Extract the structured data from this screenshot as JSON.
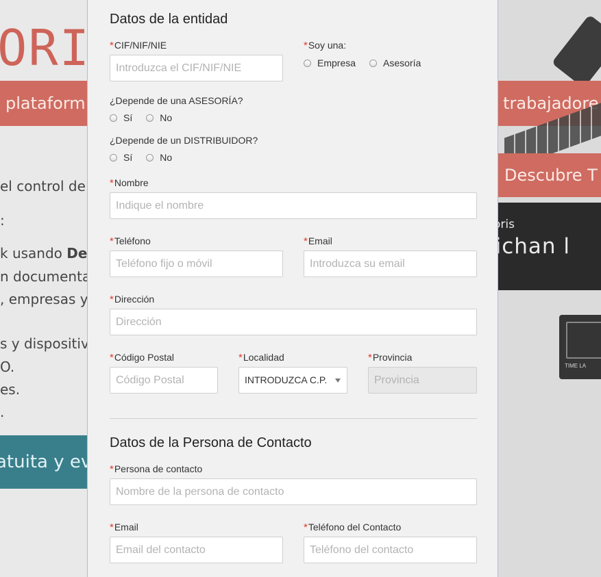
{
  "background": {
    "logo_text": "ORIS",
    "band_left": "plataform",
    "band_right_1": "s trabajadore",
    "band_right_2": "Descubre T",
    "lines": [
      {
        "pre": "el control de p",
        "bold": ""
      },
      {
        "pre": ":",
        "bold": ""
      },
      {
        "pre": "k usando ",
        "bold": "Del"
      },
      {
        "pre": "n documental",
        "bold": ""
      },
      {
        "pre": ", empresas y t",
        "bold": ""
      },
      {
        "pre": "s y dispositivo",
        "bold": ""
      },
      {
        "pre": "O.",
        "bold": ""
      },
      {
        "pre": "es.",
        "bold": ""
      },
      {
        "pre": ".",
        "bold": ""
      }
    ],
    "teal_band": "atuita y ev",
    "dark_small": "oris",
    "dark_big": "Fichan l",
    "device_label": "TIME LA"
  },
  "form": {
    "entity_title": "Datos de la entidad",
    "cif": {
      "label": "CIF/NIF/NIE",
      "placeholder": "Introduzca el CIF/NIF/NIE"
    },
    "soy_una": {
      "label": "Soy una:",
      "options": [
        "Empresa",
        "Asesoría"
      ]
    },
    "asesoria": {
      "label": "¿Depende de una ASESORÍA?",
      "options": [
        "Sí",
        "No"
      ]
    },
    "distribuidor": {
      "label": "¿Depende de un DISTRIBUIDOR?",
      "options": [
        "Sí",
        "No"
      ]
    },
    "nombre": {
      "label": "Nombre",
      "placeholder": "Indique el nombre"
    },
    "telefono": {
      "label": "Teléfono",
      "placeholder": "Teléfono fijo o móvil"
    },
    "email": {
      "label": "Email",
      "placeholder": "Introduzca su email"
    },
    "direccion": {
      "label": "Dirección",
      "placeholder": "Dirección"
    },
    "cp": {
      "label": "Código Postal",
      "placeholder": "Código Postal"
    },
    "localidad": {
      "label": "Localidad",
      "value": "INTRODUZCA C.P."
    },
    "provincia": {
      "label": "Provincia",
      "placeholder": "Provincia"
    },
    "contact_title": "Datos de la Persona de Contacto",
    "persona": {
      "label": "Persona de contacto",
      "placeholder": "Nombre de la persona de contacto"
    },
    "contact_email": {
      "label": "Email",
      "placeholder": "Email del contacto"
    },
    "contact_tel": {
      "label": "Teléfono del Contacto",
      "placeholder": "Teléfono del contacto"
    },
    "required_mark": "*"
  },
  "colors": {
    "required": "#e0392b",
    "brand_red": "#c9574b",
    "teal": "#1e6e7c"
  }
}
